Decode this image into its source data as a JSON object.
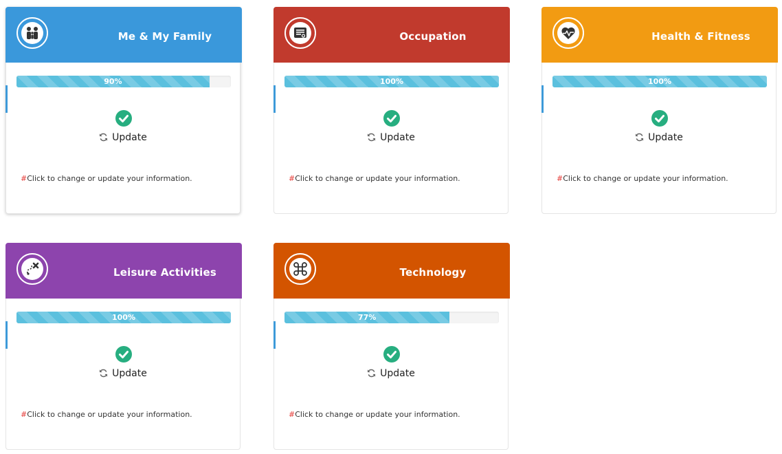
{
  "cards": [
    {
      "title": "Me & My Family",
      "icon": "family-icon",
      "color": "#3a98db",
      "progress_label": "90%",
      "progress_value": 0.9,
      "update_label": "Update",
      "hint_prefix": "#",
      "hint_text": "Click to change or update your information."
    },
    {
      "title": "Occupation",
      "icon": "certificate-icon",
      "color": "#c13a2d",
      "progress_label": "100%",
      "progress_value": 1.0,
      "update_label": "Update",
      "hint_prefix": "#",
      "hint_text": "Click to change or update your information."
    },
    {
      "title": "Health & Fitness",
      "icon": "heartbeat-icon",
      "color": "#f29b12",
      "progress_label": "100%",
      "progress_value": 1.0,
      "update_label": "Update",
      "hint_prefix": "#",
      "hint_text": "Click to change or update your information."
    },
    {
      "title": "Leisure Activities",
      "icon": "treasure-map-icon",
      "color": "#8d44ad",
      "progress_label": "100%",
      "progress_value": 1.0,
      "update_label": "Update",
      "hint_prefix": "#",
      "hint_text": "Click to change or update your information."
    },
    {
      "title": "Technology",
      "icon": "command-key-icon",
      "color": "#d35400",
      "progress_label": "77%",
      "progress_value": 0.77,
      "update_label": "Update",
      "hint_prefix": "#",
      "hint_text": "Click to change or update your information."
    }
  ],
  "colors": {
    "progress": "#5bc0de",
    "check": "#27ae80",
    "marker": "#3d9ad9"
  }
}
